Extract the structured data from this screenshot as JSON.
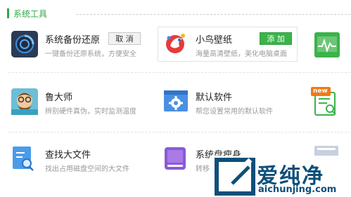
{
  "section": {
    "title": "系统工具"
  },
  "tools": [
    {
      "name": "系统备份还原",
      "desc": "一键备份还原系统，方便安全",
      "action": "取 消"
    },
    {
      "name": "小鸟壁纸",
      "desc": "海量高清壁纸，美化电脑桌面",
      "action": "添 加"
    },
    {
      "name": "鲁大师",
      "desc": "辨别硬件真伪，实时监测温度"
    },
    {
      "name": "默认软件",
      "desc": "帮您设置常用的默认软件"
    },
    {
      "name": "查找大文件",
      "desc": "找出占用磁盘空间的大文件"
    },
    {
      "name": "系统盘瘦身",
      "desc": "转移"
    }
  ],
  "badges": {
    "new": "new"
  },
  "watermark": {
    "text": "爱纯净",
    "url": "aichunjing.com"
  },
  "icons": {
    "backup": "backup-disc-icon",
    "bird": "bird-wallpaper-icon",
    "monitor": "monitor-pulse-icon",
    "ludashi": "ludashi-face-icon",
    "defaultsw": "default-software-gear-icon",
    "newdoc": "new-document-search-icon",
    "findfile": "find-file-icon",
    "diskslim": "disk-slim-icon",
    "partial": "partial-tool-icon"
  }
}
